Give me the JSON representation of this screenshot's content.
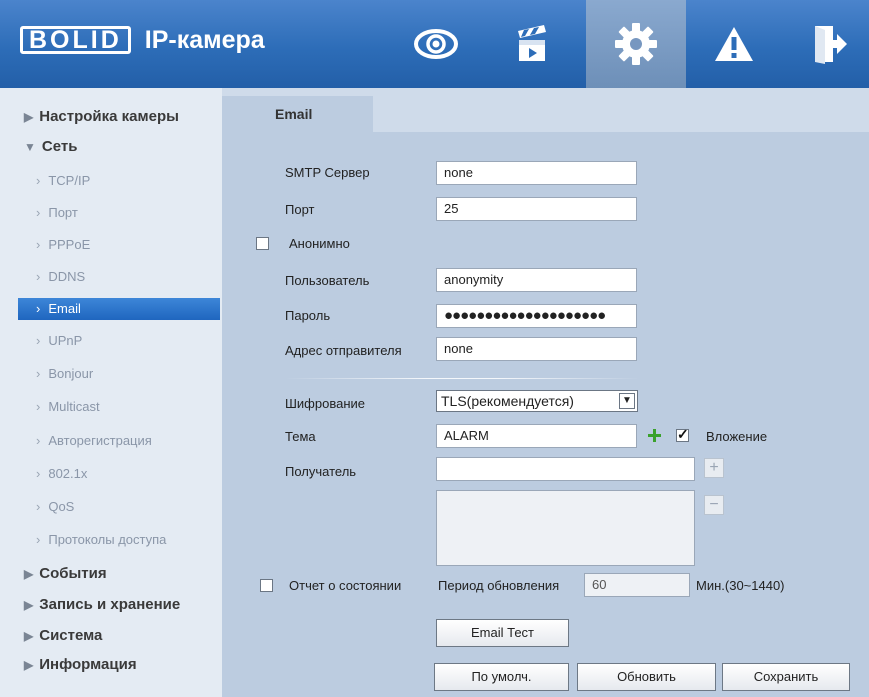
{
  "header": {
    "logo_text": "BOLID",
    "app_title": "IP-камера",
    "nav_icons": [
      "eye-icon",
      "clapperboard-icon",
      "gear-icon",
      "warning-icon",
      "logout-icon"
    ],
    "active_nav": "gear-icon",
    "colors": {
      "header_blue": "#2d6db8",
      "active_tab": "#7797c0"
    }
  },
  "sidebar": {
    "groups": [
      {
        "label": "Настройка камеры",
        "expanded": false
      },
      {
        "label": "Сеть",
        "expanded": true
      },
      {
        "label": "События",
        "expanded": false
      },
      {
        "label": "Запись и хранение",
        "expanded": false
      },
      {
        "label": "Система",
        "expanded": false
      },
      {
        "label": "Информация",
        "expanded": false
      }
    ],
    "network_items": [
      "TCP/IP",
      "Порт",
      "PPPoE",
      "DDNS",
      "Email",
      "UPnP",
      "Bonjour",
      "Multicast",
      "Авторегистрация",
      "802.1x",
      "QoS",
      "Протоколы доступа"
    ],
    "active_item": "Email",
    "active_color": "#2a74cc"
  },
  "main": {
    "tab": "Email",
    "smtp_server_label": "SMTP Сервер",
    "smtp_server_value": "none",
    "port_label": "Порт",
    "port_value": "25",
    "anonymous_label": "Анонимно",
    "anonymous_checked": false,
    "user_label": "Пользователь",
    "user_value": "anonymity",
    "password_label": "Пароль",
    "password_value": "●●●●●●●●●●●●●●●●●●●●",
    "sender_label": "Адрес отправителя",
    "sender_value": "none",
    "encryption_label": "Шифрование",
    "encryption_value": "TLS(рекомендуется)",
    "subject_label": "Тема",
    "subject_value": "ALARM",
    "attachment_label": "Вложение",
    "attachment_checked": true,
    "recipient_label": "Получатель",
    "recipient_value": "",
    "status_report_label": "Отчет о состоянии",
    "status_report_checked": false,
    "update_period_label": "Период обновления",
    "update_period_value": "60",
    "update_period_unit": "Мин.(30~1440)",
    "email_test_button": "Email Тест",
    "default_button": "По умолч.",
    "refresh_button": "Обновить",
    "save_button": "Сохранить"
  }
}
